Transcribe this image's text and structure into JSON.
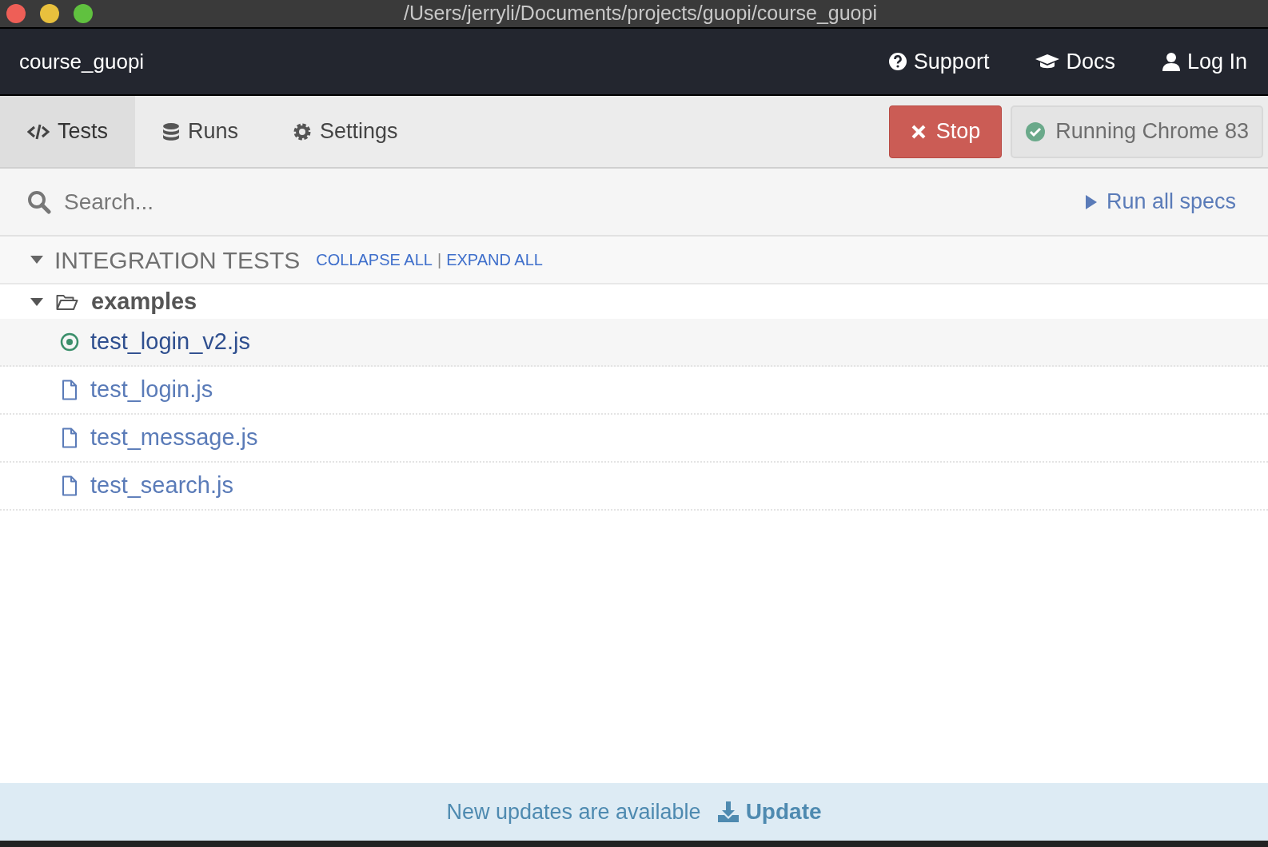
{
  "window": {
    "title": "/Users/jerryli/Documents/projects/guopi/course_guopi"
  },
  "header": {
    "project": "course_guopi",
    "links": [
      {
        "label": "Support",
        "kind": "help"
      },
      {
        "label": "Docs",
        "kind": "docs"
      },
      {
        "label": "Log In",
        "kind": "login"
      }
    ]
  },
  "tabs": [
    {
      "label": "Tests",
      "kind": "tests",
      "selected": true
    },
    {
      "label": "Runs",
      "kind": "runs",
      "selected": false
    },
    {
      "label": "Settings",
      "kind": "settings",
      "selected": false
    }
  ],
  "stop_button": "Stop",
  "browser_status": "Running Chrome 83",
  "search": {
    "placeholder": "Search..."
  },
  "run_all": "Run all specs",
  "section": {
    "title": "INTEGRATION TESTS",
    "expanded": true,
    "collapse_all": "COLLAPSE ALL",
    "separator": "|",
    "expand_all": "EXPAND ALL"
  },
  "folder": {
    "name": "examples",
    "expanded": true,
    "files": [
      {
        "name": "test_login_v2.js",
        "kind": "running",
        "selected": true
      },
      {
        "name": "test_login.js",
        "kind": "spec",
        "selected": false
      },
      {
        "name": "test_message.js",
        "kind": "spec",
        "selected": false
      },
      {
        "name": "test_search.js",
        "kind": "spec",
        "selected": false
      }
    ]
  },
  "update_bar": {
    "message": "New updates are available",
    "button": "Update"
  }
}
